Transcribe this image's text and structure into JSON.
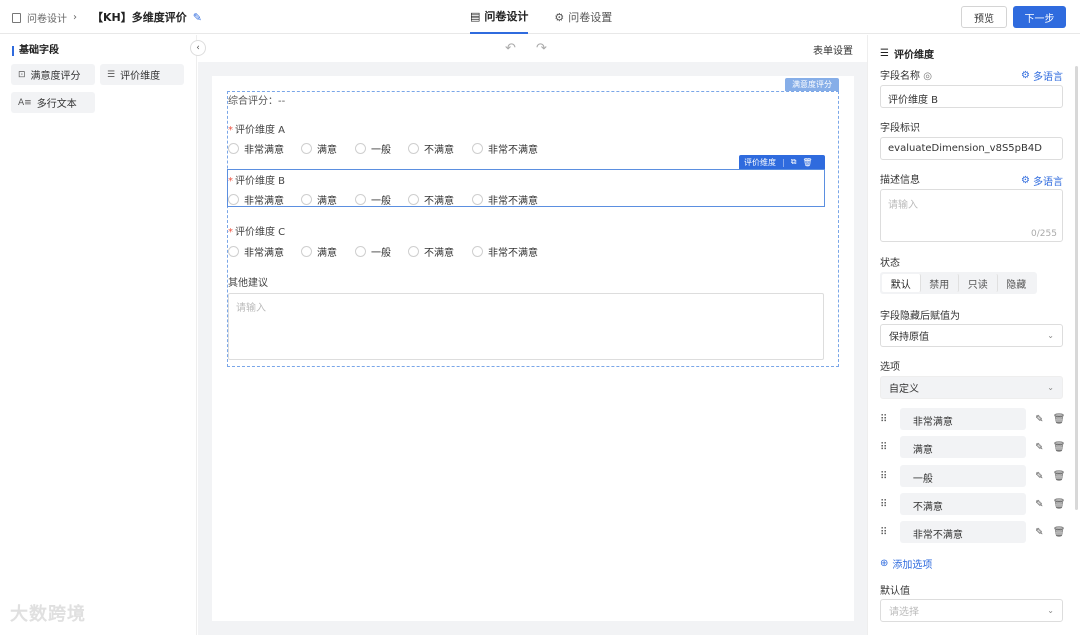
{
  "header": {
    "breadcrumb": "问卷设计",
    "title": "【KH】多维度评价",
    "tabs": [
      {
        "label": "问卷设计",
        "active": true
      },
      {
        "label": "问卷设置",
        "active": false
      }
    ],
    "preview_label": "预览",
    "next_label": "下一步"
  },
  "left": {
    "section_title": "基础字段",
    "fields": [
      "满意度评分",
      "评价维度",
      "多行文本"
    ]
  },
  "canvas": {
    "form_settings": "表单设置",
    "group_tag": "满意度评分",
    "overall": "综合评分：--",
    "questions": [
      {
        "label": "评价维度 A",
        "required": "*"
      },
      {
        "label": "评价维度 B",
        "required": "*"
      },
      {
        "label": "评价维度 C",
        "required": "*"
      }
    ],
    "options": [
      "非常满意",
      "满意",
      "一般",
      "不满意",
      "非常不满意"
    ],
    "active_tag": "评价维度",
    "other_label": "其他建议",
    "other_placeholder": "请输入"
  },
  "panel": {
    "title": "评价维度",
    "field_name_label": "字段名称",
    "multilang": "多语言",
    "field_name_value": "评价维度 B",
    "field_key_label": "字段标识",
    "field_key_value": "evaluateDimension_v8S5pB4D",
    "desc_label": "描述信息",
    "desc_placeholder": "请输入",
    "desc_counter": "0/255",
    "state_label": "状态",
    "states": [
      {
        "label": "默认",
        "on": true
      },
      {
        "label": "禁用",
        "on": false
      },
      {
        "label": "只读",
        "on": false
      },
      {
        "label": "隐藏",
        "on": false
      }
    ],
    "hidden_label": "字段隐藏后赋值为",
    "hidden_value": "保持原值",
    "options_label": "选项",
    "options_source": "自定义",
    "option_items": [
      "非常满意",
      "满意",
      "一般",
      "不满意",
      "非常不满意"
    ],
    "add_option": "添加选项",
    "default_label": "默认值",
    "default_placeholder": "请选择"
  },
  "watermark": "大数跨境",
  "colors": {
    "accent": "#2f6bde",
    "required": "#e54444"
  }
}
